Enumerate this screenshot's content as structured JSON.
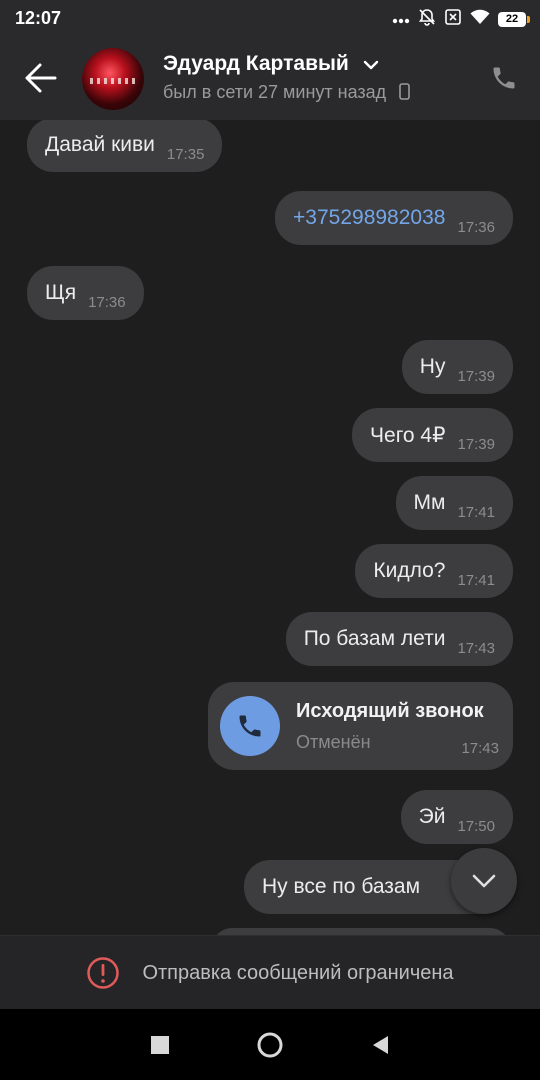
{
  "status_bar": {
    "time": "12:07",
    "battery": "22",
    "icons": [
      "dots-icon",
      "mute-bell-icon",
      "sim-x-icon",
      "wifi-icon",
      "battery-icon"
    ]
  },
  "header": {
    "contact_name": "Эдуард Картавый",
    "status": "был в сети 27 минут назад"
  },
  "messages": [
    {
      "side": "in",
      "text": "Давай киви",
      "time": "17:35"
    },
    {
      "side": "out",
      "text": "+375298982038",
      "time": "17:36",
      "link": true
    },
    {
      "side": "in",
      "text": "Щя",
      "time": "17:36"
    },
    {
      "side": "out",
      "text": "Ну",
      "time": "17:39"
    },
    {
      "side": "out",
      "text": "Чего 4₽",
      "time": "17:39"
    },
    {
      "side": "out",
      "text": "Мм",
      "time": "17:41"
    },
    {
      "side": "out",
      "text": "Кидло?",
      "time": "17:41"
    },
    {
      "side": "out",
      "text": "По базам лети",
      "time": "17:43"
    },
    {
      "side": "out",
      "text": "Эй",
      "time": "17:50"
    },
    {
      "side": "out",
      "text": "Ну все по базам",
      "time": ""
    }
  ],
  "call": {
    "title": "Исходящий звонок",
    "subtitle": "Отменён",
    "time": "17:43"
  },
  "footer": {
    "restricted_text": "Отправка сообщений ограничена"
  },
  "colors": {
    "background": "#1e1e1e",
    "bubble": "#3d3d3f",
    "link": "#73a6e8",
    "call_accent": "#6e9ce3",
    "warning": "#e05a5a"
  }
}
